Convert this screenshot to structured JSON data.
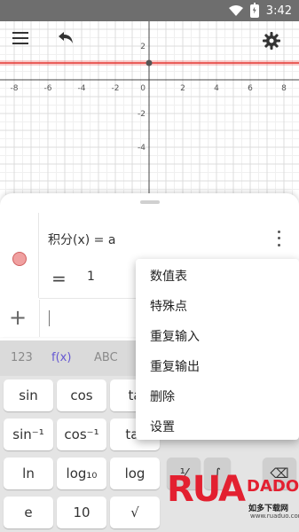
{
  "status_bar": {
    "time": "3:42"
  },
  "graph": {
    "x_ticks": [
      "-8",
      "-6",
      "-4",
      "-2",
      "2",
      "4",
      "6",
      "8"
    ],
    "y_ticks": [
      "4",
      "2",
      "-2",
      "-4"
    ],
    "origin_label": "0",
    "line_y": 1,
    "line_color": "#e53935"
  },
  "toolbar": {
    "menu_icon": "hamburger-icon",
    "undo_icon": "undo-icon",
    "settings_icon": "gear-icon"
  },
  "algebra": {
    "expression": "积分(x) = a",
    "equals_sign": "=",
    "value": "1",
    "add_label": "+"
  },
  "keyboard": {
    "tabs": [
      "123",
      "f(x)",
      "ABC"
    ],
    "active_tab": "f(x)",
    "keys": {
      "sin": "sin",
      "cos": "cos",
      "tan": "ta",
      "asin": "sin⁻¹",
      "acos": "cos⁻¹",
      "atan": "tar",
      "ln": "ln",
      "log10": "log₁₀",
      "logb": "log",
      "exp": "e",
      "pow10": "10",
      "nroot": "√",
      "frac": "⅟",
      "integral": "∫",
      "backspace": "⌫"
    }
  },
  "context_menu": {
    "items": [
      "数值表",
      "特殊点",
      "重复输入",
      "重复输出",
      "删除",
      "设置"
    ]
  },
  "watermark": {
    "brand": "RUA",
    "brand2": "DADO",
    "sub": "如多下载网",
    "url": "www.ruaduo.com"
  },
  "colors": {
    "accent": "#6557d2",
    "line": "#e53935",
    "status_bar": "#6e6e6e"
  }
}
